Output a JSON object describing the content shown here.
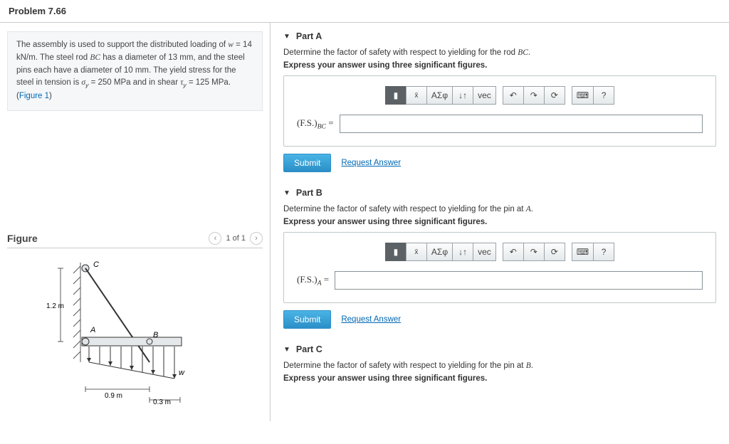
{
  "header": {
    "title": "Problem 7.66"
  },
  "problem": {
    "text1": "The assembly is used to support the distributed loading of ",
    "var_w": "w",
    "eq_w": " = 14 kN/m",
    "text2": ". The steel rod ",
    "rod": "BC",
    "text3": " has a diameter of 13 mm, and the steel pins each have a diameter of 10 mm. The yield stress for the steel in tension is ",
    "var_sy": "σ",
    "sub_y": "y",
    "eq_sy": " = 250 MPa",
    "text4": " and in shear ",
    "var_ty": "τ",
    "eq_ty": " = 125 MPa",
    "text5": ". (",
    "fig_link": "Figure 1",
    "text6": ")"
  },
  "figure": {
    "heading": "Figure",
    "pager": "1 of 1",
    "labels": {
      "C": "C",
      "A": "A",
      "B": "B",
      "w": "w",
      "d12": "1.2 m",
      "d09": "0.9 m",
      "d03": "0.3 m"
    }
  },
  "toolbar": {
    "greek": "ΑΣφ",
    "vec": "vec",
    "q": "?"
  },
  "parts": {
    "A": {
      "title": "Part A",
      "q": "Determine the factor of safety with respect to yielding for the rod BC.",
      "instr": "Express your answer using three significant figures.",
      "label_pre": "(F.S.)",
      "label_sub": "BC",
      "label_post": " ="
    },
    "B": {
      "title": "Part B",
      "q": "Determine the factor of safety with respect to yielding for the pin at A.",
      "instr": "Express your answer using three significant figures.",
      "label_pre": "(F.S.)",
      "label_sub": "A",
      "label_post": " ="
    },
    "C": {
      "title": "Part C",
      "q": "Determine the factor of safety with respect to yielding for the pin at B.",
      "instr": "Express your answer using three significant figures."
    }
  },
  "buttons": {
    "submit": "Submit",
    "request": "Request Answer"
  }
}
